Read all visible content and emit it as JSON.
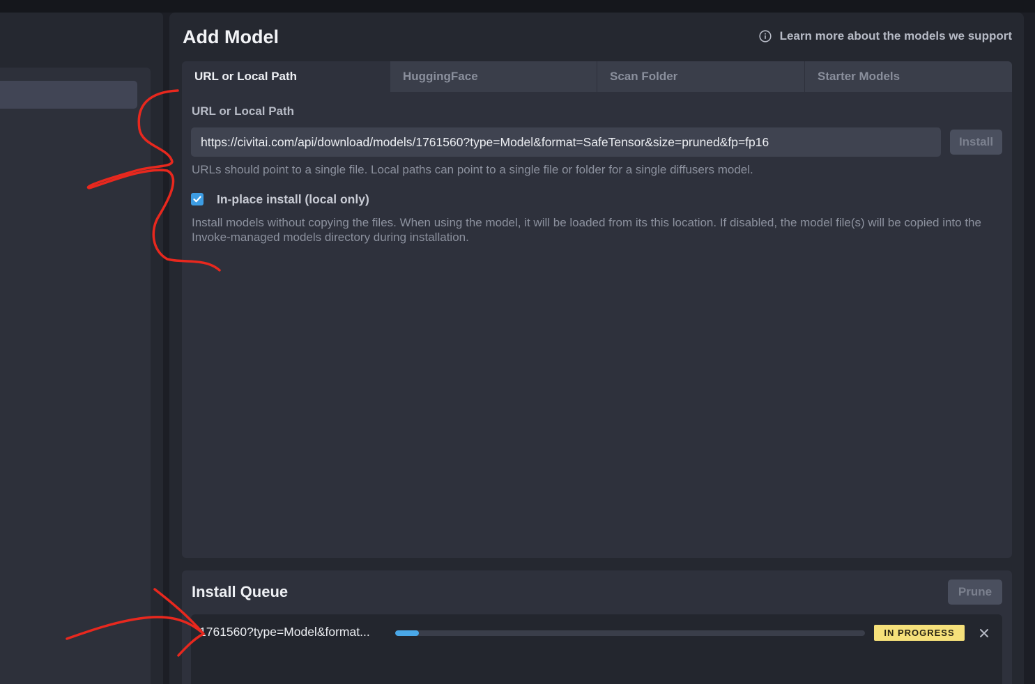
{
  "page": {
    "title": "Add Model",
    "learn_more": "Learn more about the models we support",
    "info_icon": "info-circle-icon"
  },
  "tabs": [
    {
      "label": "URL or Local Path",
      "active": true
    },
    {
      "label": "HuggingFace",
      "active": false
    },
    {
      "label": "Scan Folder",
      "active": false
    },
    {
      "label": "Starter Models",
      "active": false
    }
  ],
  "url_form": {
    "label": "URL or Local Path",
    "value": "https://civitai.com/api/download/models/1761560?type=Model&format=SafeTensor&size=pruned&fp=fp16",
    "install_label": "Install",
    "help": "URLs should point to a single file. Local paths can point to a single file or folder for a single diffusers model.",
    "inplace_label": "In-place install (local only)",
    "inplace_checked": true,
    "inplace_desc": "Install models without copying the files. When using the model, it will be loaded from its this location. If disabled, the model file(s) will be copied into the Invoke-managed models directory during installation."
  },
  "queue": {
    "title": "Install Queue",
    "prune_label": "Prune",
    "items": [
      {
        "name": "1761560?type=Model&format...",
        "progress": 0.05,
        "status": "IN PROGRESS"
      }
    ]
  },
  "colors": {
    "accent": "#3d9de4",
    "progress": "#4aa8e8",
    "status_in_progress": "#f5e07a",
    "annotation": "#e8281e"
  }
}
